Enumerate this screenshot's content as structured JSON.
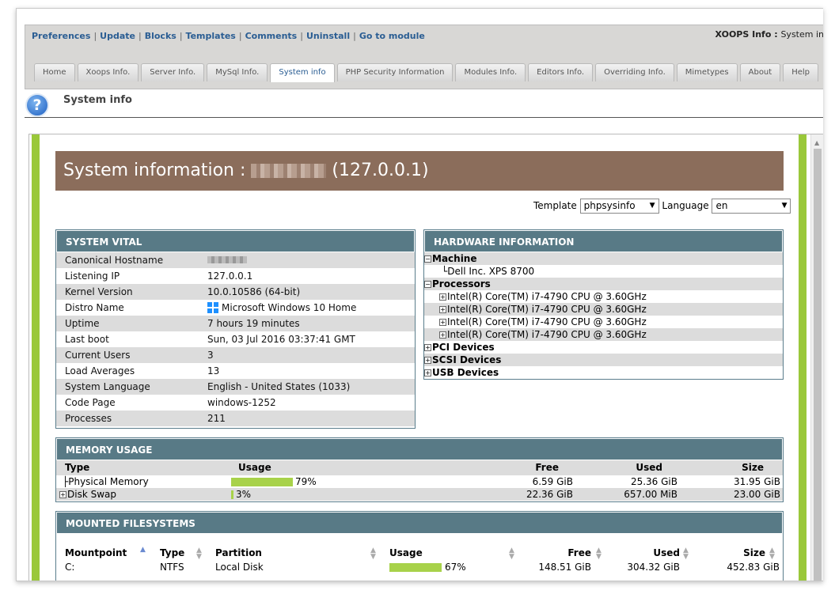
{
  "header": {
    "links": [
      "Preferences",
      "Update",
      "Blocks",
      "Templates",
      "Comments",
      "Uninstall",
      "Go to module"
    ],
    "module_title": "XOOPS Info :",
    "module_sub": "System in"
  },
  "tabs": [
    "Home",
    "Xoops Info.",
    "Server Info.",
    "MySql Info.",
    "System info",
    "PHP Security Information",
    "Modules Info.",
    "Editors Info.",
    "Overriding Info.",
    "Mimetypes",
    "About",
    "Help"
  ],
  "page": {
    "title": "System info"
  },
  "banner": {
    "prefix": "System information :",
    "ip": "(127.0.0.1)"
  },
  "controls": {
    "template_label": "Template",
    "template_value": "phpsysinfo",
    "language_label": "Language",
    "language_value": "en"
  },
  "vital": {
    "title": "SYSTEM VITAL",
    "rows": [
      {
        "k": "Canonical Hostname",
        "v": ""
      },
      {
        "k": "Listening IP",
        "v": "127.0.0.1"
      },
      {
        "k": "Kernel Version",
        "v": "10.0.10586 (64-bit)"
      },
      {
        "k": "Distro Name",
        "v": "Microsoft Windows 10 Home"
      },
      {
        "k": "Uptime",
        "v": "7 hours 19 minutes"
      },
      {
        "k": "Last boot",
        "v": "Sun, 03 Jul 2016 03:37:41 GMT"
      },
      {
        "k": "Current Users",
        "v": "3"
      },
      {
        "k": "Load Averages",
        "v": "13"
      },
      {
        "k": "System Language",
        "v": "English - United States (1033)"
      },
      {
        "k": "Code Page",
        "v": "windows-1252"
      },
      {
        "k": "Processes",
        "v": "211"
      }
    ]
  },
  "hardware": {
    "title": "HARDWARE INFORMATION",
    "machine": "Machine",
    "machine_name": "Dell Inc. XPS 8700",
    "processors": "Processors",
    "cpus": [
      "Intel(R) Core(TM) i7-4790 CPU @ 3.60GHz",
      "Intel(R) Core(TM) i7-4790 CPU @ 3.60GHz",
      "Intel(R) Core(TM) i7-4790 CPU @ 3.60GHz",
      "Intel(R) Core(TM) i7-4790 CPU @ 3.60GHz"
    ],
    "pci": "PCI Devices",
    "scsi": "SCSI Devices",
    "usb": "USB Devices"
  },
  "memory": {
    "title": "MEMORY USAGE",
    "cols": {
      "type": "Type",
      "usage": "Usage",
      "free": "Free",
      "used": "Used",
      "size": "Size"
    },
    "rows": [
      {
        "type": "Physical Memory",
        "pct": 79,
        "pct_label": "79%",
        "free": "6.59 GiB",
        "used": "25.36 GiB",
        "size": "31.95 GiB"
      },
      {
        "type": "Disk Swap",
        "pct": 3,
        "pct_label": "3%",
        "free": "22.36 GiB",
        "used": "657.00 MiB",
        "size": "23.00 GiB"
      }
    ]
  },
  "filesystems": {
    "title": "MOUNTED FILESYSTEMS",
    "cols": {
      "mount": "Mountpoint",
      "type": "Type",
      "partition": "Partition",
      "usage": "Usage",
      "free": "Free",
      "used": "Used",
      "size": "Size"
    },
    "rows": [
      {
        "mount": "C:",
        "type": "NTFS",
        "partition": "Local Disk",
        "pct": 67,
        "pct_label": "67%",
        "free": "148.51 GiB",
        "used": "304.32 GiB",
        "size": "452.83 GiB"
      }
    ]
  },
  "colors": {
    "banner": "#8b6d5b",
    "panel_header": "#587a86",
    "green_border": "#9ac83a",
    "bar": "#a8d24a",
    "link": "#2a5d93"
  }
}
